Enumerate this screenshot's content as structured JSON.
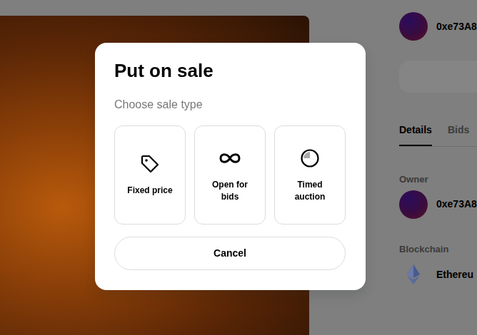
{
  "header": {
    "owner_address": "0xe73A8"
  },
  "tabs": [
    {
      "label": "Details",
      "selected": true
    },
    {
      "label": "Bids",
      "selected": false
    }
  ],
  "details": {
    "owner_label": "Owner",
    "owner_address": "0xe73A8",
    "blockchain_label": "Blockchain",
    "blockchain": "Ethereu"
  },
  "modal": {
    "title": "Put on sale",
    "subtitle": "Choose sale type",
    "options": [
      {
        "label": "Fixed price",
        "kind": "fixed"
      },
      {
        "label": "Open for bids",
        "kind": "bids"
      },
      {
        "label": "Timed auction",
        "kind": "timed"
      }
    ],
    "cancel": "Cancel"
  }
}
